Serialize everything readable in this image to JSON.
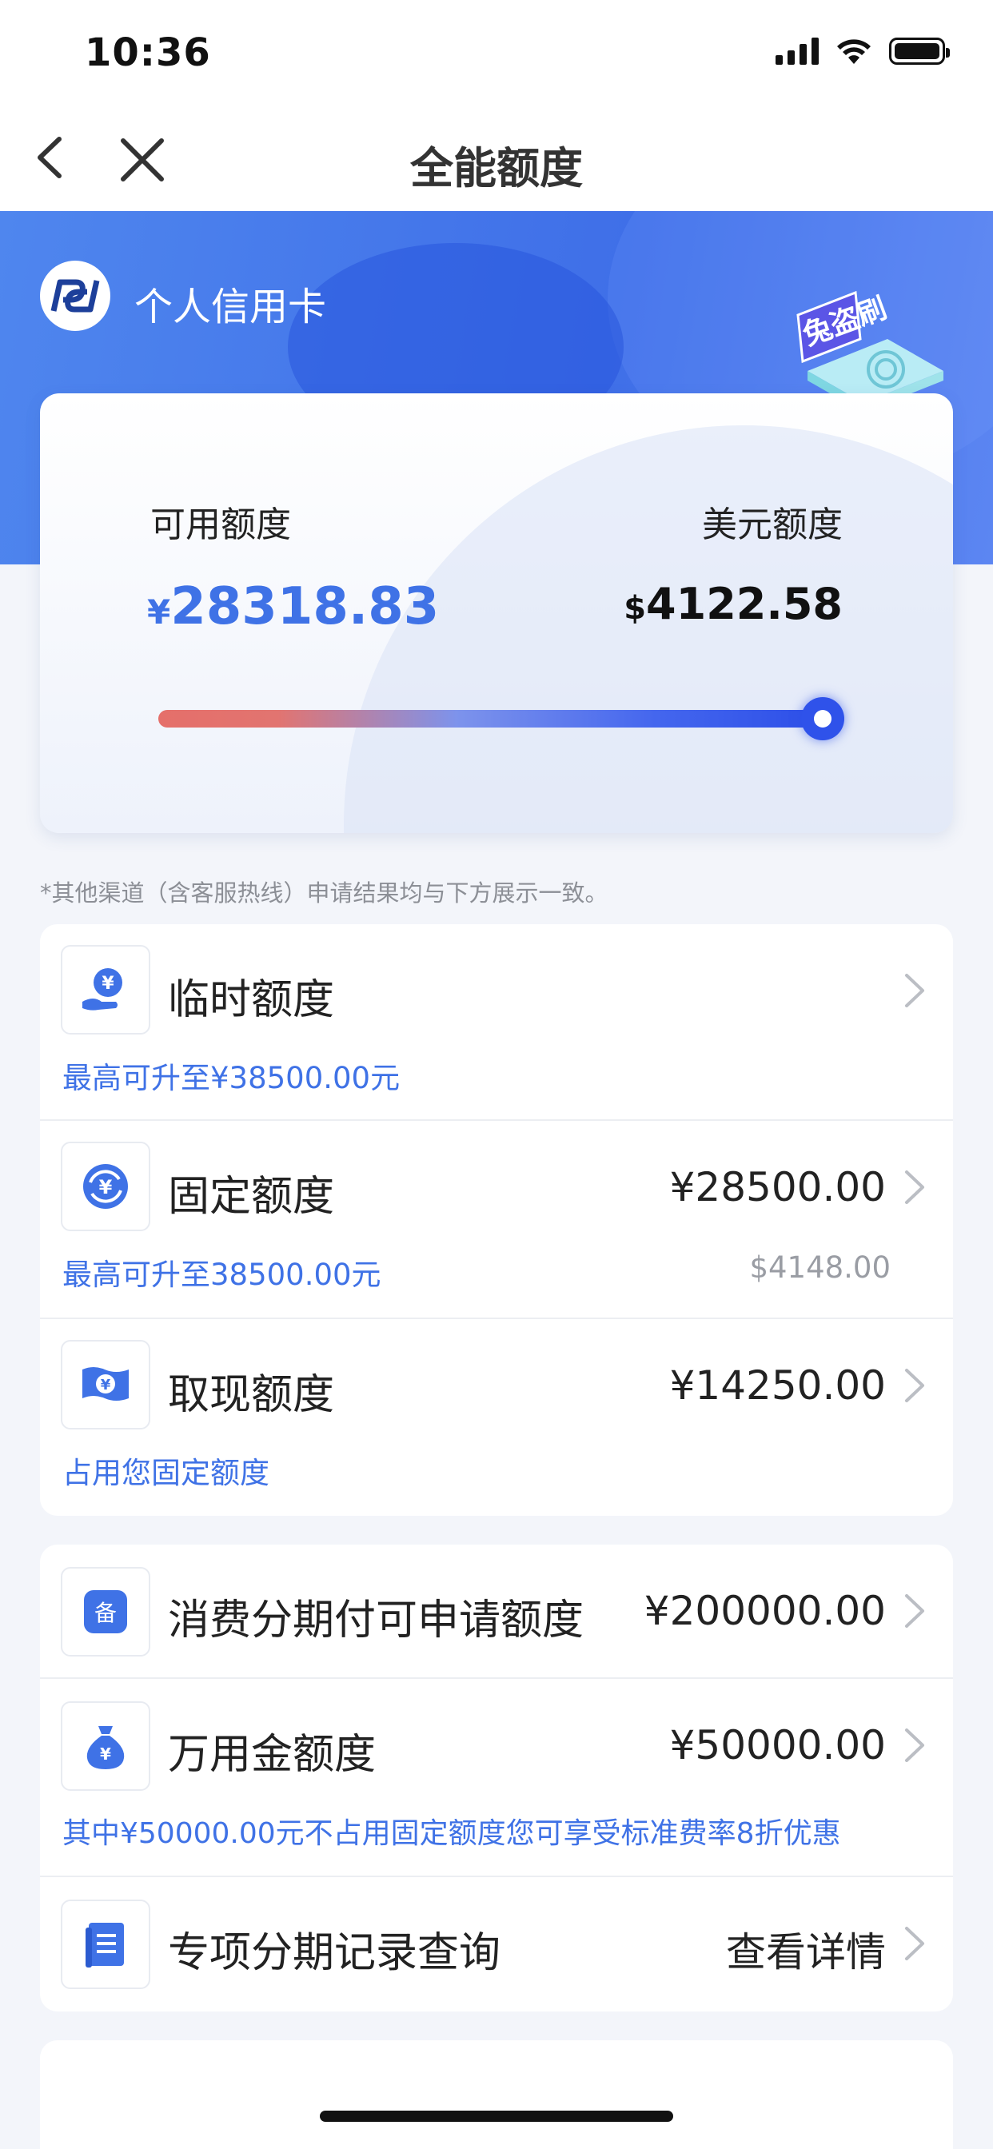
{
  "status_bar": {
    "time": "10:36"
  },
  "nav": {
    "title": "全能额度"
  },
  "header": {
    "card_name": "个人信用卡",
    "badge_text": "兔盗刷"
  },
  "limit_card": {
    "available_label": "可用额度",
    "available_currency": "¥",
    "available_amount": "28318.83",
    "usd_label": "美元额度",
    "usd_currency": "$",
    "usd_amount": "4122.58",
    "bar_fill_fraction": 1.0
  },
  "note": "*其他渠道（含客服热线）申请结果均与下方展示一致。",
  "section1": {
    "temp": {
      "name": "临时额度",
      "sub": "最高可升至¥38500.00元"
    },
    "fixed": {
      "name": "固定额度",
      "value": "¥28500.00",
      "sub": "最高可升至38500.00元",
      "sub_usd": "$4148.00"
    },
    "cash": {
      "name": "取现额度",
      "value": "¥14250.00",
      "sub": "占用您固定额度"
    }
  },
  "section2": {
    "installment": {
      "name": "消费分期付可申请额度",
      "value": "¥200000.00",
      "icon_char": "备"
    },
    "wanyong": {
      "name": "万用金额度",
      "value": "¥50000.00",
      "sub": "其中¥50000.00元不占用固定额度您可享受标准费率8折优惠"
    },
    "special": {
      "name": "专项分期记录查询",
      "value": "查看详情"
    }
  },
  "colors": {
    "accent": "#3f72e6",
    "header_blue": "#4a7bec",
    "bar_red": "#e56f6a",
    "bar_blue": "#2d4fe8"
  }
}
